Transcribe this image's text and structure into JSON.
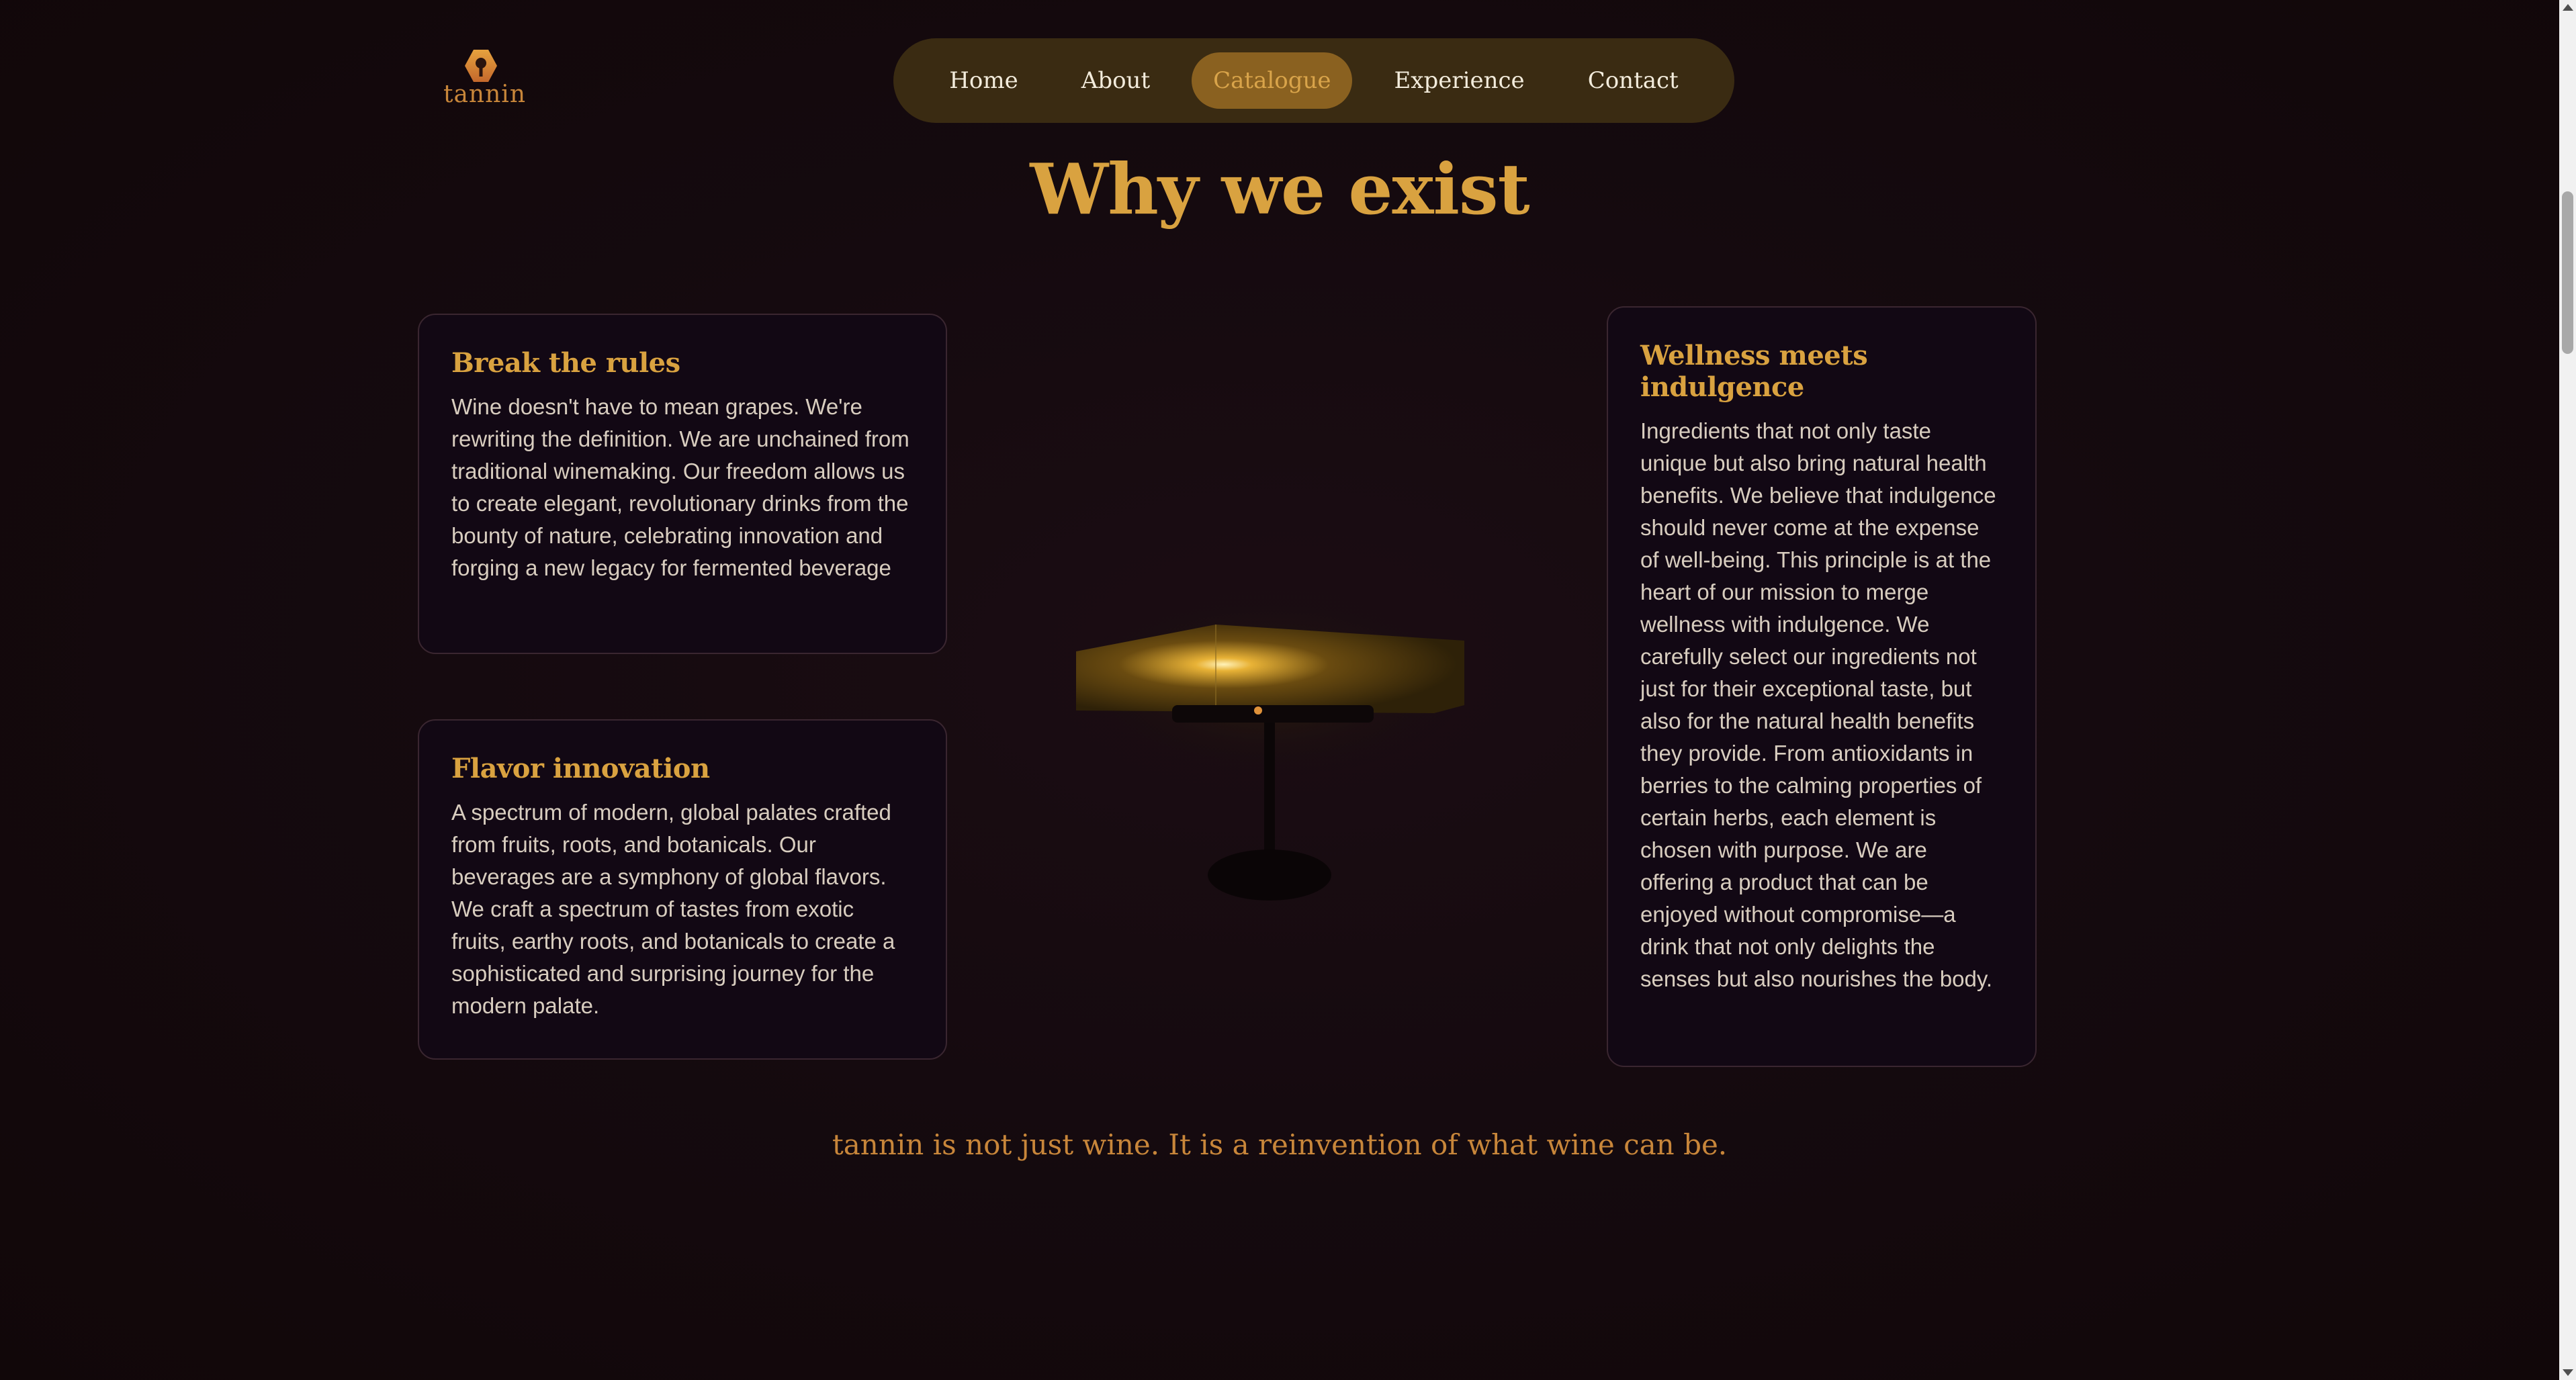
{
  "brand": {
    "name": "tannin",
    "colors": {
      "accent": "#d9a240",
      "background": "#140a0d",
      "nav_bg": "#3a2b12",
      "active_pill": "#8a6120",
      "card_bg": "#120814"
    }
  },
  "nav": {
    "items": [
      {
        "label": "Home"
      },
      {
        "label": "About"
      },
      {
        "label": "Catalogue",
        "active": true
      },
      {
        "label": "Experience"
      },
      {
        "label": "Contact"
      }
    ]
  },
  "main": {
    "title": "Why we exist",
    "cards": [
      {
        "title": "Break the rules",
        "body": "Wine doesn't have to mean grapes. We're rewriting the definition. We are unchained from traditional winemaking. Our freedom allows us to create elegant, revolutionary drinks from the bounty of nature, celebrating innovation and forging a new legacy for fermented beverage"
      },
      {
        "title": "Flavor innovation",
        "body": "A spectrum of modern, global palates crafted from fruits, roots, and botanicals. Our beverages are a symphony of global flavors. We craft a spectrum of tastes from exotic fruits, earthy roots, and botanicals to create a sophisticated and surprising journey for the modern palate."
      },
      {
        "title": "Wellness meets indulgence",
        "body": "Ingredients that not only taste unique but also bring natural health benefits. We believe that indulgence should never come at the expense of well-being. This principle is at the heart of our mission to merge wellness with indulgence. We carefully select our ingredients not just for their exceptional taste, but also for the natural health benefits they provide. From antioxidants in berries to the calming properties of certain herbs, each element is chosen with purpose. We are offering a product that can be enjoyed without compromise—a drink that not only delights the senses but also nourishes the body."
      }
    ],
    "tagline": "tannin is not just wine. It is a reinvention of what wine can be."
  },
  "icons": {
    "logo": "hexagon-logo-icon",
    "lamp": "table-lamp-illustration"
  }
}
